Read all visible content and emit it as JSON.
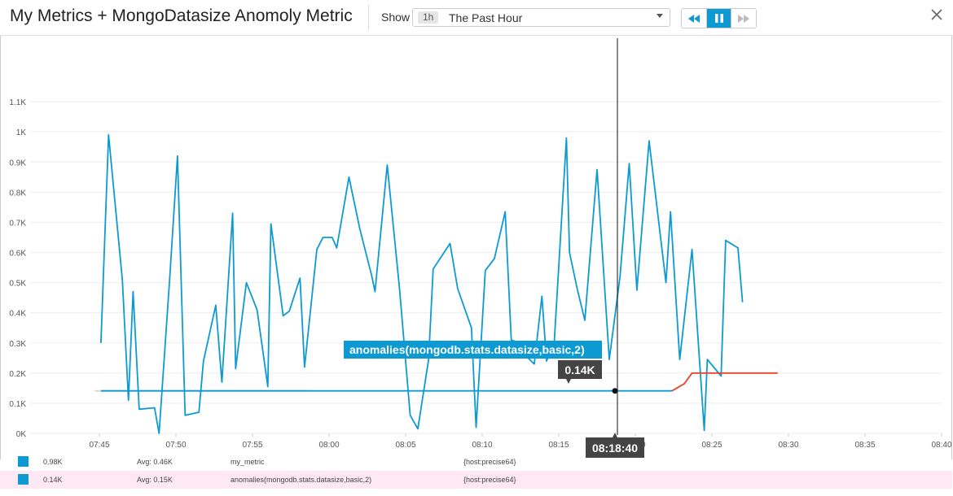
{
  "header": {
    "title": "My Metrics + MongoDatasize Anomoly Metric",
    "show_label": "Show",
    "timeframe_badge": "1h",
    "timeframe_text": "The Past Hour"
  },
  "tooltip": {
    "series_label": "anomalies(mongodb.stats.datasize,basic,2)",
    "value_label": "0.14K",
    "time_label": "08:18:40"
  },
  "legend": [
    {
      "current": "0.98K",
      "avg": "Avg: 0.46K",
      "name": "my_metric",
      "scope": "{host:precise64}"
    },
    {
      "current": "0.14K",
      "avg": "Avg: 0.15K",
      "name": "anomalies(mongodb.stats.datasize,basic,2)",
      "scope": "{host:precise64}"
    }
  ],
  "colors": {
    "series": "#0d9ad3",
    "anomaly": "#e8442b",
    "band": "#d8d8d8",
    "accent": "#0d9ad3"
  },
  "chart_data": {
    "type": "line",
    "y_ticks": [
      "0K",
      "0.1K",
      "0.2K",
      "0.3K",
      "0.4K",
      "0.5K",
      "0.6K",
      "0.7K",
      "0.8K",
      "0.9K",
      "1K",
      "1.1K"
    ],
    "x_ticks": [
      "07:45",
      "07:50",
      "07:55",
      "08:00",
      "08:05",
      "08:10",
      "08:15",
      "08:20",
      "08:25",
      "08:30",
      "08:35",
      "08:40"
    ],
    "ylim": [
      0,
      1200
    ],
    "x_range_minutes": [
      7.5,
      40.2
    ],
    "x_unit_note": "minutes after 07:00",
    "series": [
      {
        "name": "my_metric",
        "points": [
          [
            7.4,
            300
          ],
          [
            7.9,
            990
          ],
          [
            8.8,
            510
          ],
          [
            9.2,
            110
          ],
          [
            9.5,
            470
          ],
          [
            9.9,
            80
          ],
          [
            10.9,
            85
          ],
          [
            11.2,
            0
          ],
          [
            11.9,
            520
          ],
          [
            12.4,
            920
          ],
          [
            12.9,
            60
          ],
          [
            13.8,
            70
          ],
          [
            14.1,
            240
          ],
          [
            14.9,
            425
          ],
          [
            15.3,
            170
          ],
          [
            16.0,
            730
          ],
          [
            16.2,
            215
          ],
          [
            16.9,
            500
          ],
          [
            17.6,
            410
          ],
          [
            18.3,
            155
          ],
          [
            18.5,
            695
          ],
          [
            19.3,
            390
          ],
          [
            19.7,
            405
          ],
          [
            20.4,
            515
          ],
          [
            20.7,
            220
          ],
          [
            21.5,
            610
          ],
          [
            21.9,
            650
          ],
          [
            22.5,
            650
          ],
          [
            22.8,
            615
          ],
          [
            23.6,
            850
          ],
          [
            24.3,
            680
          ],
          [
            25.1,
            520
          ],
          [
            25.3,
            470
          ],
          [
            26.1,
            890
          ],
          [
            26.9,
            480
          ],
          [
            27.6,
            60
          ],
          [
            28.1,
            15
          ],
          [
            28.8,
            245
          ],
          [
            29.1,
            545
          ],
          [
            30.2,
            630
          ],
          [
            30.7,
            480
          ],
          [
            31.6,
            350
          ],
          [
            31.9,
            20
          ],
          [
            32.5,
            540
          ],
          [
            33.1,
            580
          ],
          [
            33.8,
            735
          ],
          [
            34.2,
            310
          ],
          [
            34.9,
            295
          ],
          [
            35.2,
            255
          ],
          [
            35.7,
            230
          ],
          [
            36.2,
            455
          ],
          [
            36.5,
            240
          ],
          [
            37.0,
            300
          ],
          [
            37.8,
            980
          ],
          [
            38.0,
            600
          ],
          [
            38.5,
            480
          ],
          [
            39.0,
            375
          ],
          [
            39.8,
            875
          ],
          [
            40.6,
            245
          ],
          [
            41.3,
            520
          ],
          [
            41.9,
            895
          ],
          [
            42.4,
            475
          ],
          [
            43.2,
            970
          ],
          [
            44.3,
            500
          ],
          [
            44.6,
            735
          ],
          [
            45.2,
            245
          ],
          [
            46.0,
            610
          ],
          [
            46.8,
            10
          ],
          [
            47.0,
            245
          ],
          [
            47.9,
            190
          ],
          [
            48.2,
            640
          ],
          [
            49.0,
            615
          ],
          [
            49.3,
            435
          ]
        ]
      },
      {
        "name": "anomalies(mongodb.stats.datasize,basic,2)",
        "points": [
          [
            7.4,
            141
          ],
          [
            44.7,
            141
          ]
        ]
      },
      {
        "name": "anomalies(mongodb.stats.datasize,basic,2) anomalous",
        "points": [
          [
            44.7,
            141
          ],
          [
            45.5,
            165
          ],
          [
            46.0,
            200
          ],
          [
            51.6,
            200
          ]
        ]
      }
    ],
    "band": {
      "lower": 140,
      "upper": 142,
      "x_range": [
        7.4,
        51.6
      ]
    },
    "crosshair_x": 38.67,
    "grid": true
  }
}
